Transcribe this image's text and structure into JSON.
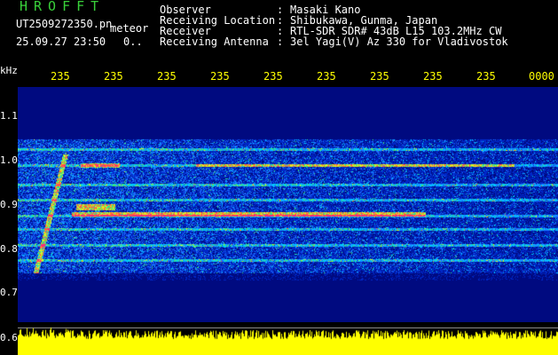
{
  "app": {
    "title": "HROFFT"
  },
  "file": {
    "name": "UT2509272350.pn",
    "suffix": "meteor"
  },
  "capture": {
    "date_time": "25.09.27 23:50",
    "counter": "0.."
  },
  "info": [
    {
      "label": "Observer",
      "value": "Masaki Kano"
    },
    {
      "label": "Receiving Location",
      "value": "Shibukawa, Gunma, Japan"
    },
    {
      "label": "Receiver",
      "value": "RTL-SDR SDR# 43dB L15 103.2MHz CW"
    },
    {
      "label": "Receiving Antenna",
      "value": "3el Yagi(V) Az 330 for Vladivostok"
    }
  ],
  "info_separator": ":",
  "axis": {
    "unit": "kHz",
    "y_ticks": [
      "1.1",
      "1.0",
      "0.9",
      "0.8",
      "0.7",
      "0.6"
    ],
    "time_ticks": [
      "235",
      "235",
      "235",
      "235",
      "235",
      "235",
      "235",
      "235",
      "235",
      "0000"
    ]
  },
  "colors": {
    "background": "#000000",
    "noise_floor": "#000a80",
    "tick_text": "#ffff00",
    "title_text": "#39d03a",
    "power_trace": "#ffff00"
  }
}
